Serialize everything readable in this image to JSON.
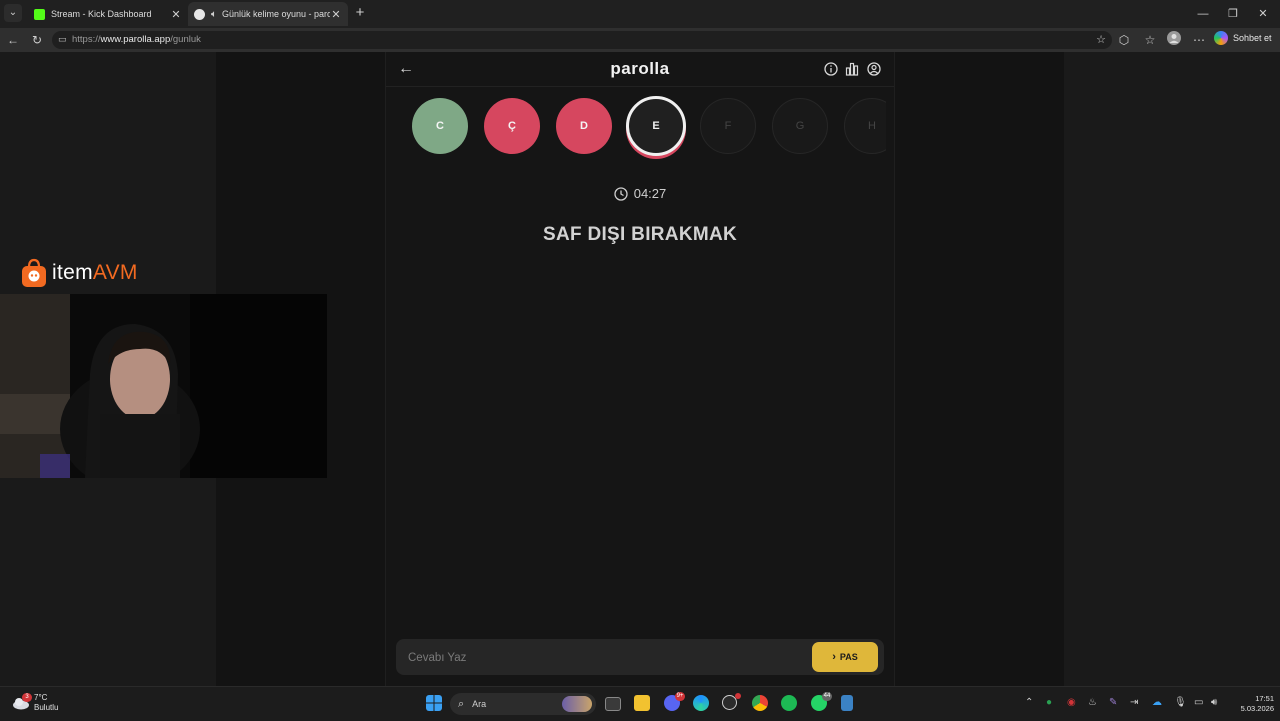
{
  "browser": {
    "tabs": [
      {
        "title": "Stream - Kick Dashboard",
        "active": false,
        "favicon_color": "#53fc18"
      },
      {
        "title": "Günlük kelime oyunu - parolla",
        "active": true,
        "favicon_color": "#e6e6e6"
      }
    ],
    "url_prefix": "https://",
    "url_host": "www.parolla.app",
    "url_path": "/gunluk",
    "copilot_label": "Sohbet et"
  },
  "app": {
    "brand": "parolla",
    "letters": [
      {
        "letter": "C",
        "state": "correct"
      },
      {
        "letter": "Ç",
        "state": "wrong"
      },
      {
        "letter": "D",
        "state": "wrong"
      },
      {
        "letter": "E",
        "state": "active"
      },
      {
        "letter": "F",
        "state": "pending"
      },
      {
        "letter": "G",
        "state": "pending"
      },
      {
        "letter": "H",
        "state": "pending"
      }
    ],
    "timer": "04:27",
    "question": "SAF DIŞI BIRAKMAK",
    "answer_placeholder": "Cevabı Yaz",
    "pass_label": "PAS",
    "colors": {
      "correct": "#7fa886",
      "wrong": "#d6475f",
      "pass": "#dfb73a"
    }
  },
  "overlay": {
    "sponsor_name_a": "item",
    "sponsor_name_b": "AVM"
  },
  "taskbar": {
    "weather_temp": "7°C",
    "weather_desc": "Bulutlu",
    "weather_badge": "3",
    "search_label": "Ara",
    "discord_badge": "9+",
    "whatsapp_badge": "44",
    "time": "17:51",
    "date": "5.03.2026"
  }
}
